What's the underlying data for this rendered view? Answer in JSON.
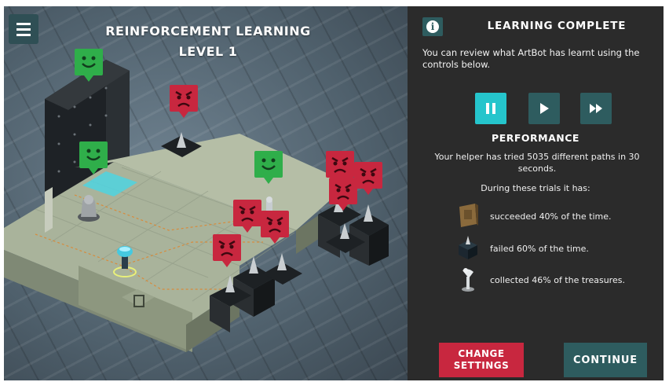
{
  "game": {
    "title_line1": "REINFORCEMENT LEARNING",
    "title_line2": "LEVEL 1",
    "menu_icon": "hamburger-menu-icon"
  },
  "panel": {
    "title": "LEARNING COMPLETE",
    "intro": "You can review what ArtBot has learnt using the controls below.",
    "controls": [
      {
        "name": "pause",
        "icon": "pause-icon",
        "active": true
      },
      {
        "name": "play",
        "icon": "play-icon",
        "active": false
      },
      {
        "name": "fast-forward",
        "icon": "fast-forward-icon",
        "active": false
      }
    ],
    "performance_title": "PERFORMANCE",
    "summary": "Your helper has tried 5035 different paths in 30 seconds.",
    "during": "During these trials it has:",
    "stats": [
      {
        "icon": "treasure-door-icon",
        "text": "succeeded 40% of the time.",
        "percent": 40
      },
      {
        "icon": "spike-block-icon",
        "text": "failed 60% of the time.",
        "percent": 60
      },
      {
        "icon": "statue-treasure-icon",
        "text": "collected 46% of the treasures.",
        "percent": 46
      }
    ],
    "change_settings": "CHANGE\nSETTINGS",
    "continue": "CONTINUE"
  },
  "colors": {
    "panel_bg": "#2b2b2b",
    "teal": "#2e5c5f",
    "teal_active": "#25c5cc",
    "red": "#c8273f",
    "green_marker": "#2fae4a",
    "red_marker": "#c8273f"
  }
}
